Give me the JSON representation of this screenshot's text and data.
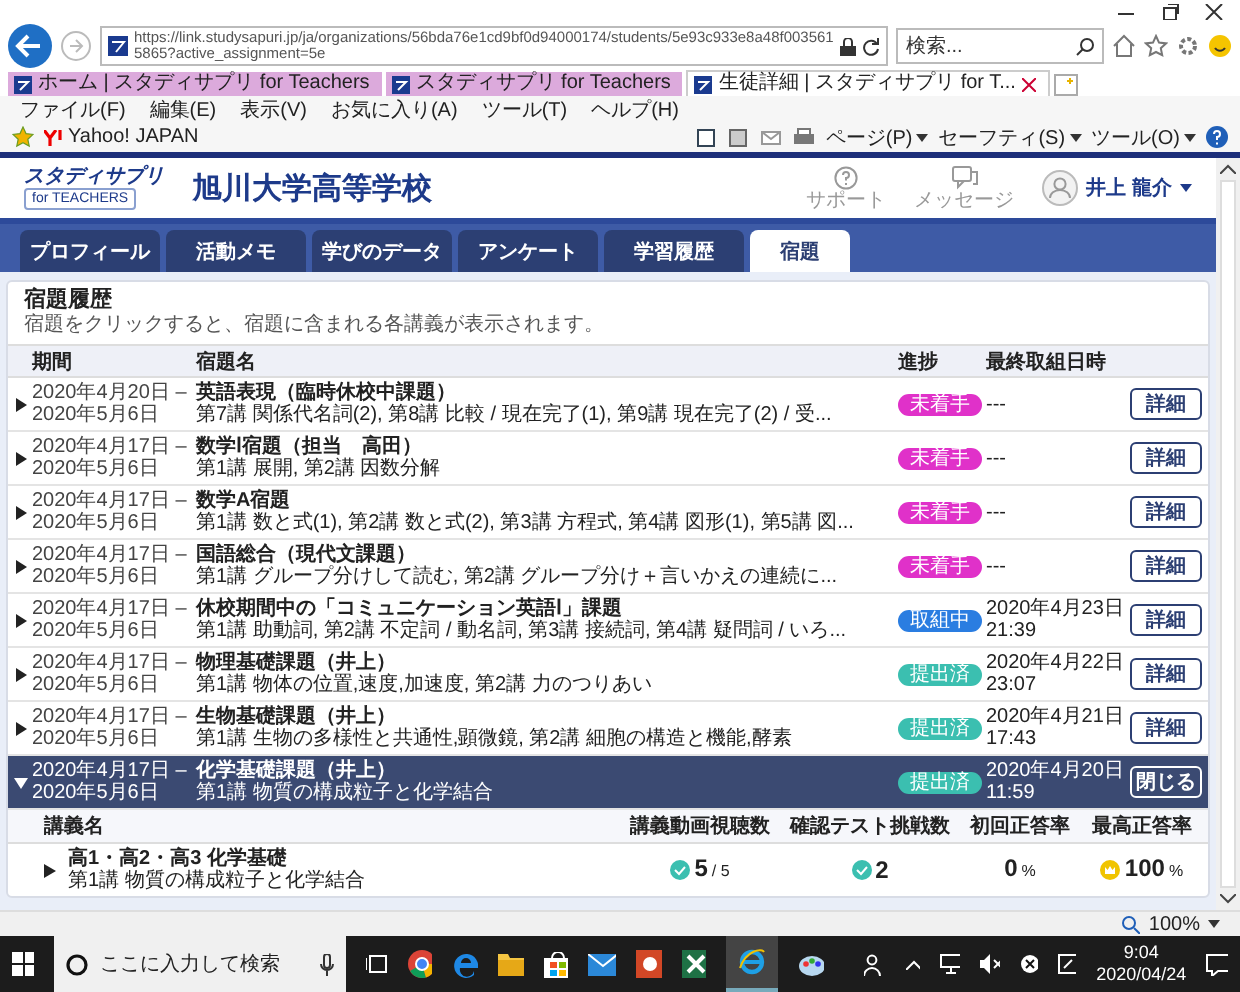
{
  "browser": {
    "url": "https://link.studysapuri.jp/ja/organizations/56bda76e1cd9bf0d94000174/students/5e93c933e8a48f0035615865?active_assignment=5e",
    "search_placeholder": "検索...",
    "tabs": [
      {
        "label": "ホーム | スタディサプリ for Teachers",
        "selected": false
      },
      {
        "label": "スタディサプリ for Teachers",
        "selected": false
      },
      {
        "label": "生徒詳細 | スタディサプリ for T...",
        "selected": true
      }
    ],
    "menu": [
      "ファイル(F)",
      "編集(E)",
      "表示(V)",
      "お気に入り(A)",
      "ツール(T)",
      "ヘルプ(H)"
    ],
    "favorites": [
      "Yahoo! JAPAN"
    ],
    "toolbar": [
      "ページ(P)",
      "セーフティ(S)",
      "ツール(O)"
    ]
  },
  "header": {
    "logo_top": "スタディサプリ",
    "logo_bottom": "for TEACHERS",
    "school": "旭川大学高等学校",
    "links": [
      "サポート",
      "メッセージ"
    ],
    "user": "井上 龍介"
  },
  "nav_tabs": [
    {
      "label": "プロフィール",
      "selected": false
    },
    {
      "label": "活動メモ",
      "selected": false
    },
    {
      "label": "学びのデータ",
      "selected": false
    },
    {
      "label": "アンケート",
      "selected": false
    },
    {
      "label": "学習履歴",
      "selected": false
    },
    {
      "label": "宿題",
      "selected": true
    }
  ],
  "homework": {
    "title": "宿題履歴",
    "hint": "宿題をクリックすると、宿題に含まれる各講義が表示されます。",
    "columns": [
      "期間",
      "宿題名",
      "進捗",
      "最終取組日時"
    ],
    "rows": [
      {
        "period": "2020年4月20日 – 2020年5月6日",
        "title": "英語表現（臨時休校中課題）",
        "subtitle": "第7講 関係代名詞(2), 第8講 比較 / 現在完了(1), 第9講 現在完了(2) / 受...",
        "status": "未着手",
        "color": "#e031c9",
        "last": "---",
        "button": "詳細",
        "expanded": false
      },
      {
        "period": "2020年4月17日 – 2020年5月6日",
        "title": "数学Ⅰ宿題（担当　高田）",
        "subtitle": "第1講 展開, 第2講 因数分解",
        "status": "未着手",
        "color": "#e031c9",
        "last": "---",
        "button": "詳細",
        "expanded": false
      },
      {
        "period": "2020年4月17日 – 2020年5月6日",
        "title": "数学A宿題",
        "subtitle": "第1講 数と式(1), 第2講 数と式(2), 第3講 方程式, 第4講 図形(1), 第5講 図...",
        "status": "未着手",
        "color": "#e031c9",
        "last": "---",
        "button": "詳細",
        "expanded": false
      },
      {
        "period": "2020年4月17日 – 2020年5月6日",
        "title": "国語総合（現代文課題）",
        "subtitle": "第1講 グループ分けして読む, 第2講 グループ分け＋言いかえの連続に...",
        "status": "未着手",
        "color": "#e031c9",
        "last": "---",
        "button": "詳細",
        "expanded": false
      },
      {
        "period": "2020年4月17日 – 2020年5月6日",
        "title": "休校期間中の「コミュニケーション英語Ⅰ」課題",
        "subtitle": "第1講 助動詞, 第2講 不定詞 / 動名詞, 第3講 接続詞, 第4講 疑問詞 / いろ...",
        "status": "取組中",
        "color": "#2a7de1",
        "last": "2020年4月23日 21:39",
        "button": "詳細",
        "expanded": false
      },
      {
        "period": "2020年4月17日 – 2020年5月6日",
        "title": "物理基礎課題（井上）",
        "subtitle": "第1講 物体の位置,速度,加速度, 第2講 力のつりあい",
        "status": "提出済",
        "color": "#3bbfb0",
        "last": "2020年4月22日 23:07",
        "button": "詳細",
        "expanded": false
      },
      {
        "period": "2020年4月17日 – 2020年5月6日",
        "title": "生物基礎課題（井上）",
        "subtitle": "第1講 生物の多様性と共通性,顕微鏡, 第2講 細胞の構造と機能,酵素",
        "status": "提出済",
        "color": "#3bbfb0",
        "last": "2020年4月21日 17:43",
        "button": "詳細",
        "expanded": false
      },
      {
        "period": "2020年4月17日 – 2020年5月6日",
        "title": "化学基礎課題（井上）",
        "subtitle": "第1講 物質の構成粒子と化学結合",
        "status": "提出済",
        "color": "#3bbfb0",
        "last": "2020年4月20日 11:59",
        "button": "閉じる",
        "expanded": true
      }
    ],
    "detail": {
      "columns": [
        "講義名",
        "講義動画視聴数",
        "確認テスト挑戦数",
        "初回正答率",
        "最高正答率"
      ],
      "rows": [
        {
          "title": "高1・高2・高3 化学基礎",
          "subtitle": "第1講 物質の構成粒子と化学結合",
          "views": "5",
          "views_total": "/ 5",
          "tests": "2",
          "first_rate": "0",
          "first_unit": "%",
          "best_rate": "100",
          "best_unit": "%"
        }
      ]
    }
  },
  "status_bar": {
    "zoom": "100%"
  },
  "taskbar": {
    "search_placeholder": "ここに入力して検索",
    "time": "9:04",
    "date": "2020/04/24"
  }
}
